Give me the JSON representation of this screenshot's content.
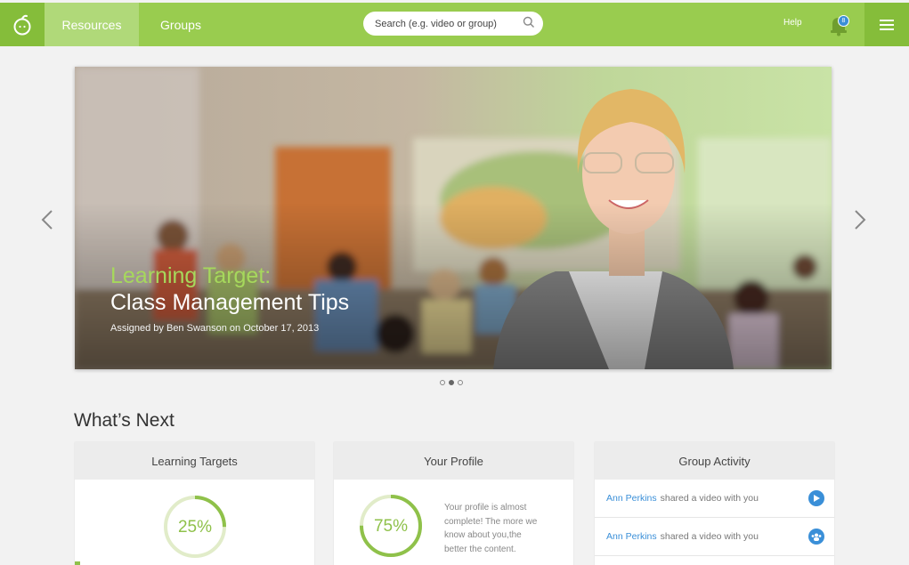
{
  "nav": {
    "logo_icon": "apple-logo-icon",
    "tabs": [
      {
        "label": "Resources",
        "active": true
      },
      {
        "label": "Groups",
        "active": false
      }
    ],
    "search_placeholder": "Search (e.g. video or group)",
    "help_label": "Help",
    "notification_count": "8",
    "colors": {
      "bar": "#99cc4f",
      "active_tab": "#b0d979",
      "dark": "#85bd3a"
    }
  },
  "hero": {
    "kicker": "Learning Target:",
    "title": "Class Management Tips",
    "subtitle": "Assigned by Ben Swanson on October 17, 2013",
    "slide_count": 3,
    "active_slide": 2
  },
  "section_title": "What’s Next",
  "cards": {
    "learning_targets": {
      "title": "Learning Targets",
      "percent_label": "25%",
      "progress": 0.25
    },
    "profile": {
      "title": "Your Profile",
      "percent_label": "75%",
      "progress": 0.75,
      "lines": [
        "Your profile is almost",
        "complete! The more we",
        "know about you,the",
        "better the content."
      ]
    },
    "activity": {
      "title": "Group Activity",
      "items": [
        {
          "name": "Ann Perkins",
          "text": "shared a video with you",
          "icon": "play-icon"
        },
        {
          "name": "Ann Perkins",
          "text": "shared a video with you",
          "icon": "group-icon"
        }
      ]
    }
  }
}
